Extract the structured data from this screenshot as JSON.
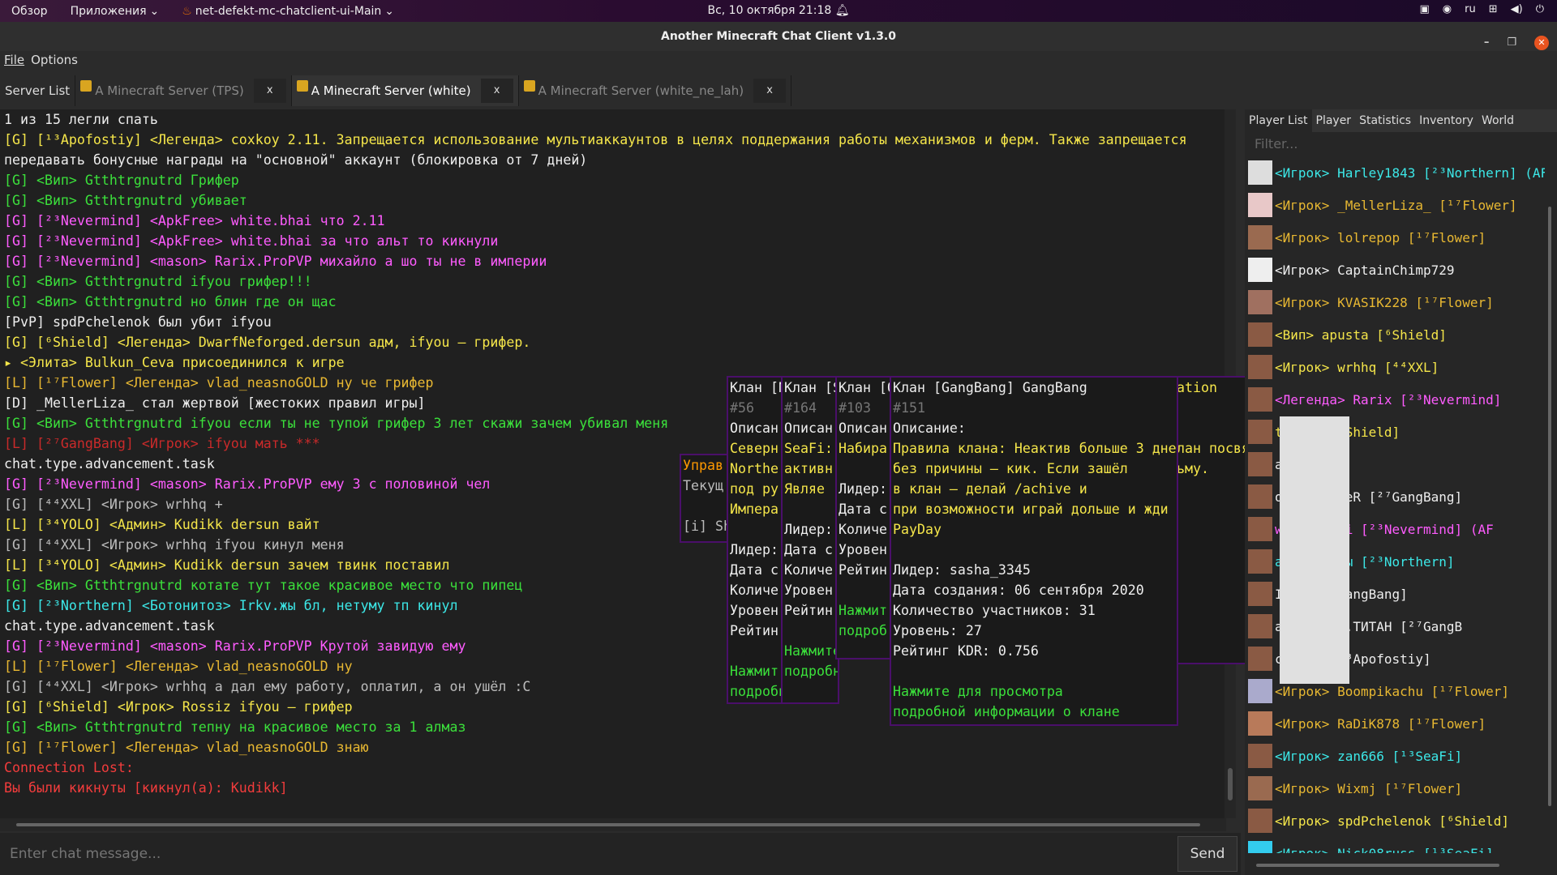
{
  "topbar": {
    "overview": "Обзор",
    "apps": "Приложения",
    "app_name": "net-defekt-mc-chatclient-ui-Main",
    "clock": "Вс, 10 октября  21:18",
    "lang": "ru"
  },
  "window": {
    "title": "Another Minecraft Chat Client v1.3.0"
  },
  "menu": {
    "file": "File",
    "options": "Options"
  },
  "tabs": {
    "server_list": "Server List",
    "t1": "A Minecraft Server (TPS)",
    "t2": "A Minecraft Server (white)",
    "t3": "A Minecraft Server (white_ne_lah)",
    "close": "x"
  },
  "chat": [
    "1 из 15 легли спать",
    "[G] [¹³Apofostiy] <Легенда> coxkoy  2.11. Запрещается использование мультиаккаунтов в целях поддержания работы механизмов и ферм. Также запрещается",
    "передавать бонусные награды на \"основной\" аккаунт (блокировка от 7 дней)",
    "[G] <Вип> Gtthtrgnutrd  Грифер",
    "[G] <Вип> Gtthtrgnutrd  убивает",
    "[G] [²³Nevermind] <ApkFree> white.bhai  что 2.11",
    "[G] [²³Nevermind] <ApkFree> white.bhai  за что альт то кикнули",
    "[G] [²³Nevermind] <mason> Rarix.ProPVP  михайло а шо ты не в империи",
    "[G] <Вип> Gtthtrgnutrd   ifyou грифер!!!",
    "[G] <Вип> Gtthtrgnutrd   но блин где он щас",
    "[PvP] spdPchelenok был убит ifyou",
    "[G] [⁶Shield] <Легенда> DwarfNeforged.dersun   адм, ifyou – грифер.",
    "▸ <Элита> Bulkun_Ceva присоединился к игре",
    "[L] [¹⁷Flower] <Легенда> vlad_neasnoGOLD  ну че грифер",
    "[D] _MellerLiza_ стал жертвой [жестоких правил игры]",
    "[G] <Вип> Gtthtrgnutrd   ifyou если ты не тупой грифер 3 лет скажи зачем убивал меня",
    "[L] [²⁷GangBang] <Игрок> ifyou   мать ***",
    "chat.type.advancement.task",
    "[G] [²³Nevermind] <mason> Rarix.ProPVP   ему 3 с половиной чел",
    "[G] [⁴⁴XXL] <Игрок> wrhhq   +",
    "[L] [³⁴YOLO] <Админ> Kudikk dersun   вайт",
    "[G] [⁴⁴XXL] <Игрок> wrhhq   ifyou кинул меня",
    "[L] [³⁴YOLO] <Админ> Kudikk dersun   зачем твинк поставил",
    "[G] <Вип> Gtthtrgnutrd   котате тут такое красивое место что пипец",
    "[G] [²³Northern] <Ботонитоз> Irkv.жы   бл, нетуму тп кинул",
    "chat.type.advancement.task",
    "[G] [²³Nevermind] <mason> Rarix.ProPVP   Крутой завидую ему",
    "[L] [¹⁷Flower] <Легенда> vlad_neasnoGOLD   ну",
    "[G] [⁴⁴XXL] <Игрок> wrhhq   а дал ему работу, оплатил, а он ушёл :C",
    "[G] [⁶Shield] <Игрок> Rossiz   ifyou – грифер",
    "[G] <Вип> Gtthtrgnutrd   тепну на красивое место за 1 алмаз",
    "[G] [¹⁷Flower] <Легенда> vlad_neasnoGOLD   знаю",
    "Connection Lost:",
    "Вы были кикнуты [кикнул(а): Kudikk]"
  ],
  "input": {
    "placeholder": "Enter chat message...",
    "send": "Send"
  },
  "right": {
    "tabs": [
      "Player List",
      "Player",
      "Statistics",
      "Inventory",
      "World"
    ],
    "filter": "Filter..."
  },
  "players": [
    "<Игрок> Harley1843 [²³Northern] (AF",
    "<Игрок> _MellerLiza_ [¹⁷Flower]",
    "<Игрок> lolrepop [¹⁷Flower]",
    "<Игрок> CaptainChimp729",
    "<Игрок> KVASIK228 [¹⁷Flower]",
    "<Вип> apusta [⁶Shield]",
    "<Игрок> wrhhq [⁴⁴XXL]",
    "<Легенда> Rarix [²³Nevermind]",
    "tikul2 [⁶Shield]",
    "adus535c",
    "oPnIJ_BoBeR [²⁷GangBang]",
    "white.bhai [²³Nevermind] (AF",
    "a> Irkv.жы [²³Northern]",
    "IDUN [²⁷GangBang]",
    "asha_3345.ТИТАН [²⁷GangB",
    "coxkoy [¹³Apofostiy]",
    "<Игрок> Boompikachu [¹⁷Flower]",
    "<Игрок> RaDiK878 [¹⁷Flower]",
    "<Игрок> zan666 [¹³SeaFi]",
    "<Игрок> Wixmj [¹⁷Flower]",
    "<Игрок> spdPchelenok [⁶Shield]",
    "<Игрок> Nick08russ [¹³SeaFi]"
  ],
  "tooltip_main": [
    "Клан [GangBang] GangBang",
    "#151",
    "Описание:",
    "Правила клана: Неактив больше 3 дней",
    " без причины – кик. Если зашёл",
    "в клан – делай /achive и",
    "при возможности играй дольше и жди",
    "PayDay",
    "",
    "Лидер: sasha_3345",
    "Дата создания: 06 сентября 2020",
    "Количество участников: 31",
    "Уровень: 27",
    "Рейтинг KDR: 0.756",
    "",
    "Нажмите для просмотра",
    "подробной информации о клане"
  ],
  "tooltip_a": [
    "Клан [N",
    "#56",
    "Описан",
    "Северн",
    "Northe",
    "под ру",
    " Импера",
    "",
    "Лидер:",
    "Дата с",
    "Количе",
    "Уровен",
    "Рейтин",
    "",
    "Нажмит",
    "подробной информаци"
  ],
  "tooltip_b": [
    "Клан [S",
    "#164",
    "Описан",
    "SeaFi: S",
    "активн",
    "Являе",
    "",
    "Лидер:",
    "Дата с",
    "Количе",
    "Уровен",
    "Рейтин",
    "",
    "Нажмите для п",
    "подробной инф"
  ],
  "tooltip_c": [
    "Клан [O",
    "#103",
    "Описан",
    "Набира",
    "",
    "Лидер:",
    "Дата с",
    "Количе",
    "Уровен",
    "Рейтин",
    "",
    "Нажмит",
    "подроб"
  ],
  "tooltip_d": [
    "Управ",
    "Текущ",
    "",
    "[i] Shif"
  ],
  "tooltip_e": [
    "ation",
    "",
    "",
    "лан посвящен",
    "ьму."
  ]
}
